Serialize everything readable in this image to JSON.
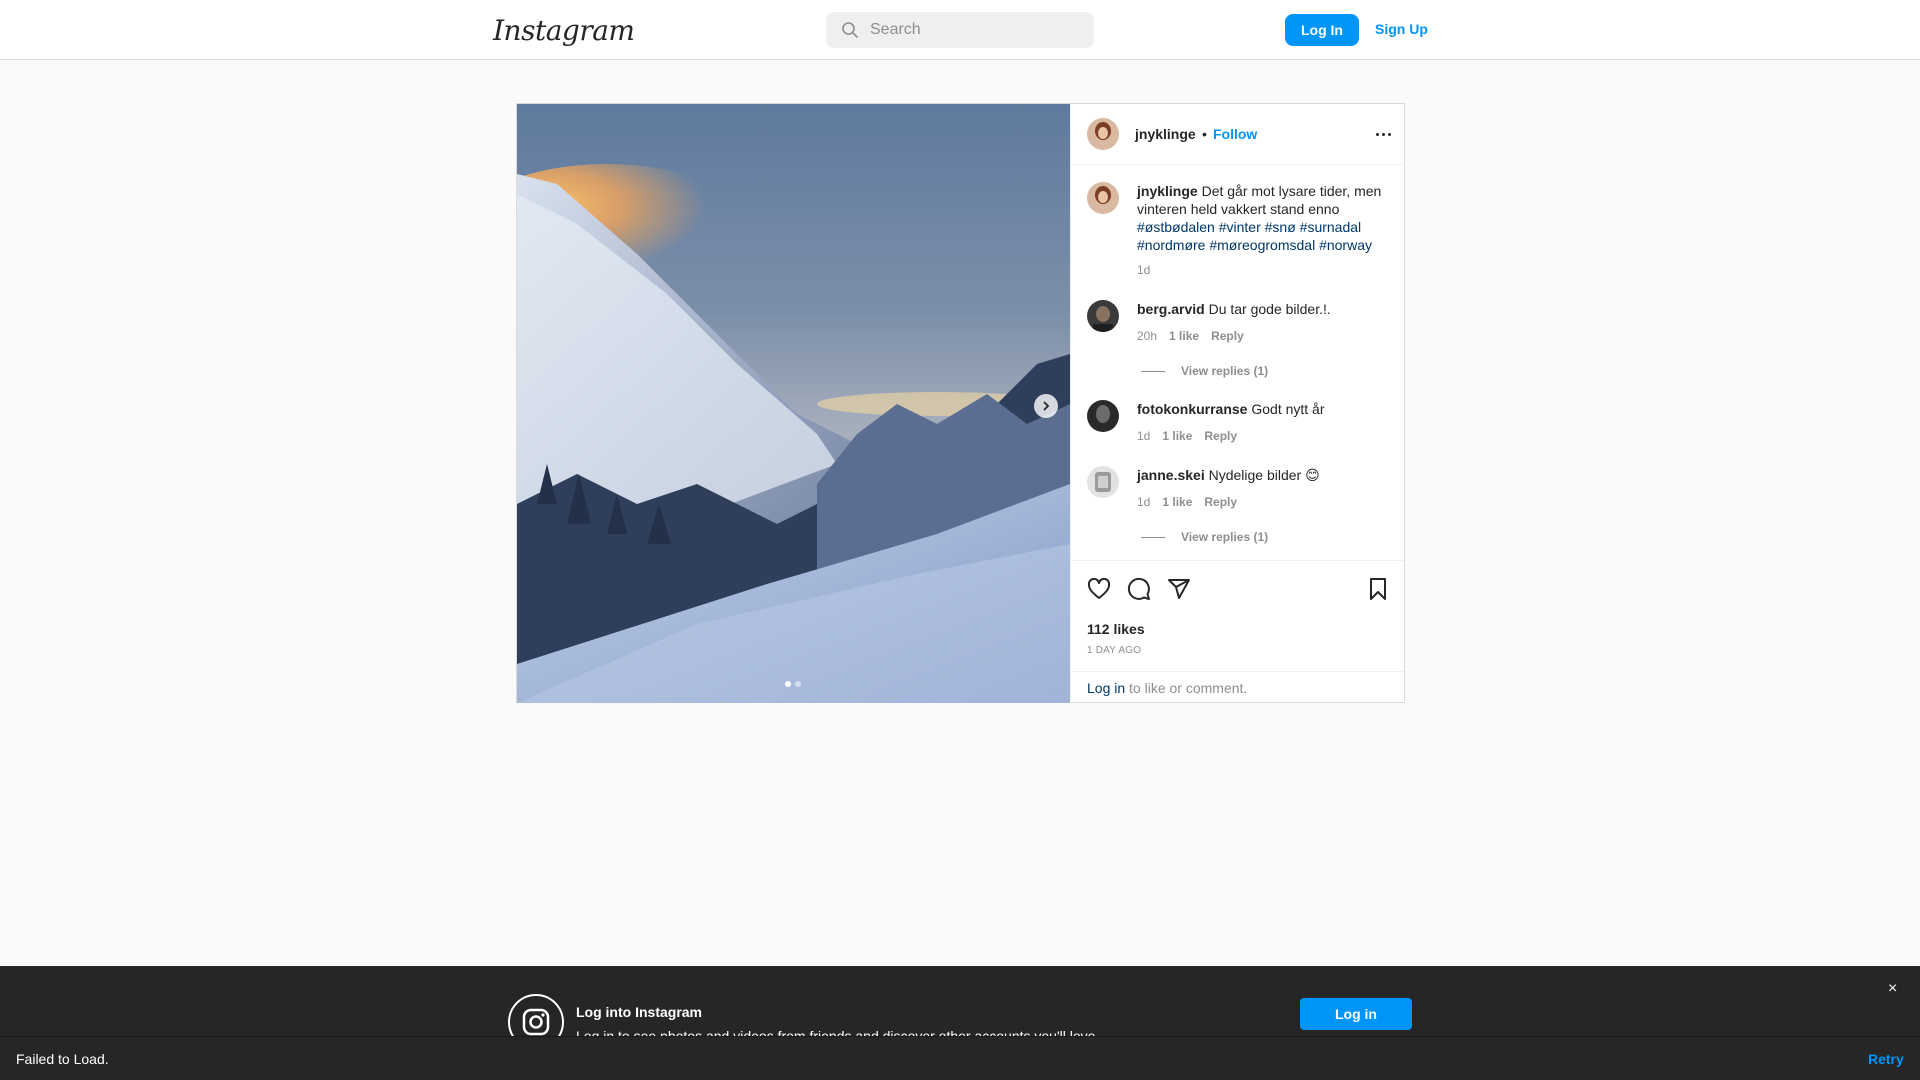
{
  "nav": {
    "logo_text": "Instagram",
    "search_placeholder": "Search",
    "login_label": "Log In",
    "signup_label": "Sign Up"
  },
  "post": {
    "author": "jnyklinge",
    "separator": "•",
    "follow_label": "Follow",
    "carousel": {
      "current": 1,
      "total": 2
    },
    "caption": {
      "user": "jnyklinge",
      "text": "Det går mot lysare tider, men vinteren held vakkert stand enno",
      "tags": [
        "#østbødalen",
        "#vinter",
        "#snø",
        "#surnadal",
        "#nordmøre",
        "#møreogromsdal",
        "#norway"
      ],
      "time": "1d"
    },
    "comments": [
      {
        "user": "berg.arvid",
        "text": "Du tar gode bilder.!.",
        "time": "20h",
        "likes": "1 like",
        "reply": "Reply",
        "view_replies": "View replies (1)"
      },
      {
        "user": "fotokonkurranse",
        "text": "Godt nytt år⁣",
        "time": "1d",
        "likes": "1 like",
        "reply": "Reply"
      },
      {
        "user": "janne.skei",
        "text": "Nydelige bilder 😊",
        "time": "1d",
        "likes": "1 like",
        "reply": "Reply",
        "view_replies": "View replies (1)"
      }
    ],
    "likes": "112 likes",
    "posted": "1 DAY AGO",
    "login_link": "Log in",
    "login_rest": " to like or comment."
  },
  "banner": {
    "title": "Log into Instagram",
    "subtitle": "Log in to see photos and videos from friends and discover other accounts you'll love.",
    "login_label": "Log in",
    "close": "×"
  },
  "toast": {
    "message": "Failed to Load.",
    "retry": "Retry"
  }
}
